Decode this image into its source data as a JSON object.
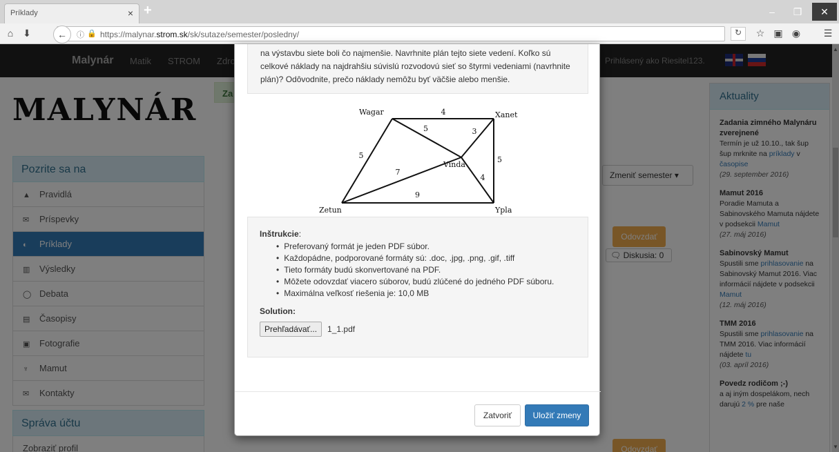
{
  "browser": {
    "tab_title": "Príklady",
    "tab_close": "×",
    "new_tab": "+",
    "url_prefix": "https://malynar.",
    "url_domain": "strom.sk",
    "url_path": "/sk/sutaze/semester/posledny/",
    "min": "–",
    "max": "❐",
    "close": "✕"
  },
  "navbar": {
    "brand": "Malynár",
    "links": [
      "Matik",
      "STROM",
      "Zdro"
    ],
    "logged_in": "Prihlásený ako Riesitel123."
  },
  "logo": "MALYNÁR",
  "sidebar": {
    "heading": "Pozrite sa na",
    "items": [
      {
        "label": "Pravidlá",
        "icon": "▲"
      },
      {
        "label": "Príspevky",
        "icon": "✉"
      },
      {
        "label": "Príklady",
        "icon": "◐"
      },
      {
        "label": "Výsledky",
        "icon": "▥"
      },
      {
        "label": "Debata",
        "icon": "◯"
      },
      {
        "label": "Časopisy",
        "icon": "▤"
      },
      {
        "label": "Fotografie",
        "icon": "▣"
      },
      {
        "label": "Mamut",
        "icon": "♆"
      },
      {
        "label": "Kontakty",
        "icon": "✉"
      }
    ],
    "account_heading": "Správa účtu",
    "profile_link": "Zobraziť profil"
  },
  "center": {
    "panel_label": "Za",
    "zmenit": "Zmeniť semester ▾",
    "odovzdat": "Odovzdať",
    "diskusia": "Diskusia: 0"
  },
  "news": {
    "heading": "Aktuality",
    "items": [
      {
        "title": "Zadania zimného Malynáru zverejnené",
        "body": "Termín je už 10.10., tak šup šup mrknite na",
        "link": "príklady",
        "tail": "v",
        "link2": "časopise",
        "date": "(29. september 2016)"
      },
      {
        "title": "Mamut 2016",
        "body": "Poradie Mamuta a Sabinovského Mamuta nájdete v podsekcii",
        "link": "Mamut",
        "date": "(27. máj 2016)"
      },
      {
        "title": "Sabinovský Mamut",
        "body": "Spustili sme",
        "link": "prihlasovanie",
        "tail": "na Sabinovský Mamut 2016. Viac informácií nájdete v podsekcii",
        "link2": "Mamut",
        "date": "(12. máj 2016)"
      },
      {
        "title": "TMM 2016",
        "body": "Spustili sme",
        "link": "prihlasovanie",
        "tail": "na TMM 2016. Viac informácií nájdete",
        "link2": "tu",
        "date": "(03. apríl 2016)"
      },
      {
        "title": "Povedz rodičom ;-)",
        "body": "a aj iným dospelákom, nech darujú",
        "link": "2 %",
        "tail": "pre naše"
      }
    ]
  },
  "modal": {
    "task_text": "na výstavbu siete boli čo najmenšie. Navrhnite plán tejto siete vedení. Koľko sú celkové náklady na najdrahšiu súvislú rozvodovú sieť so štyrmi vedeniami (navrhnite plán)? Odôvodnite, prečo náklady nemôžu byť väčšie alebo menšie.",
    "diagram": {
      "nodes": [
        {
          "id": "Wagar",
          "label": "Wagar"
        },
        {
          "id": "Xanet",
          "label": "Xanet"
        },
        {
          "id": "Vinda",
          "label": "Vinda"
        },
        {
          "id": "Zetun",
          "label": "Zetun"
        },
        {
          "id": "Ypla",
          "label": "Ypla"
        }
      ],
      "edges": [
        {
          "from": "Wagar",
          "to": "Xanet",
          "weight": "4"
        },
        {
          "from": "Wagar",
          "to": "Vinda",
          "weight": "5"
        },
        {
          "from": "Xanet",
          "to": "Vinda",
          "weight": "3"
        },
        {
          "from": "Wagar",
          "to": "Zetun",
          "weight": "5"
        },
        {
          "from": "Xanet",
          "to": "Ypla",
          "weight": "5"
        },
        {
          "from": "Zetun",
          "to": "Vinda",
          "weight": "7"
        },
        {
          "from": "Vinda",
          "to": "Ypla",
          "weight": "4"
        },
        {
          "from": "Zetun",
          "to": "Ypla",
          "weight": "9"
        }
      ]
    },
    "instructions_title": "Inštrukcie",
    "instructions_colon": ":",
    "instructions": [
      "Preferovaný formát je jeden PDF súbor.",
      "Každopádne, podporované formáty sú: .doc, .jpg, .png, .gif, .tiff",
      "Tieto formáty budú skonvertované na PDF.",
      "Môžete odovzdať viacero súborov, budú zlúčené do jedného PDF súboru.",
      "Maximálna veľkosť riešenia je: 10,0 MB"
    ],
    "solution_label": "Solution:",
    "browse_label": "Prehľadávať...",
    "file_name": "1_1.pdf",
    "close_button": "Zatvoriť",
    "save_button": "Uložiť zmeny"
  }
}
